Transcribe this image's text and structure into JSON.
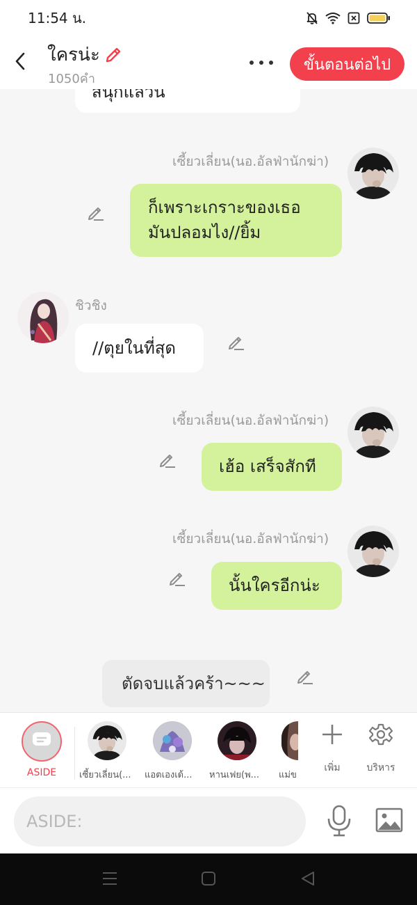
{
  "status_bar": {
    "time": "11:54 น."
  },
  "header": {
    "title": "ใครน่ะ",
    "word_count": "1050คำ",
    "next_label": "ขั้นตอนต่อไป",
    "accent_color": "#f2404d"
  },
  "messages": {
    "partial_top": "สนุกแล้วน",
    "m1": {
      "sender": "เซี้ยวเลี่ยน(นอ.อัลฟ่านักฆ่า)",
      "line1": "ก็เพราะเกราะของเธอ",
      "line2": "มันปลอมไง//ยิ้ม"
    },
    "m2": {
      "sender": "ชิวชิง",
      "text": "//ตุยในที่สุด"
    },
    "m3": {
      "sender": "เซี้ยวเลี่ยน(นอ.อัลฟ่านักฆ่า)",
      "text": "เฮ้อ เสร็จสักที"
    },
    "m4": {
      "sender": "เซี้ยวเลี่ยน(นอ.อัลฟ่านักฆ่า)",
      "text": "นั้นใครอีกน่ะ"
    },
    "aside": {
      "text": "ตัดจบแล้วคร้า~~~"
    }
  },
  "character_bar": {
    "aside_label": "ASIDE",
    "characters": [
      {
        "name": "เซี้ยวเลี่ยน(..."
      },
      {
        "name": "แอตเองเด้..."
      },
      {
        "name": "หานเฟย(พ..."
      },
      {
        "name": "แม่ข"
      }
    ],
    "add_label": "เพิ่ม",
    "manage_label": "บริหาร"
  },
  "input": {
    "placeholder": "ASIDE:",
    "value": ""
  },
  "icons": {
    "back": "chevron-left-icon",
    "edit": "pencil-icon",
    "more": "more-dots-icon",
    "mic": "microphone-icon",
    "image": "image-icon",
    "add": "plus-icon",
    "manage": "gear-icon"
  },
  "colors": {
    "green_bubble": "#d4f29b",
    "chat_bg": "#f6f6f6"
  }
}
